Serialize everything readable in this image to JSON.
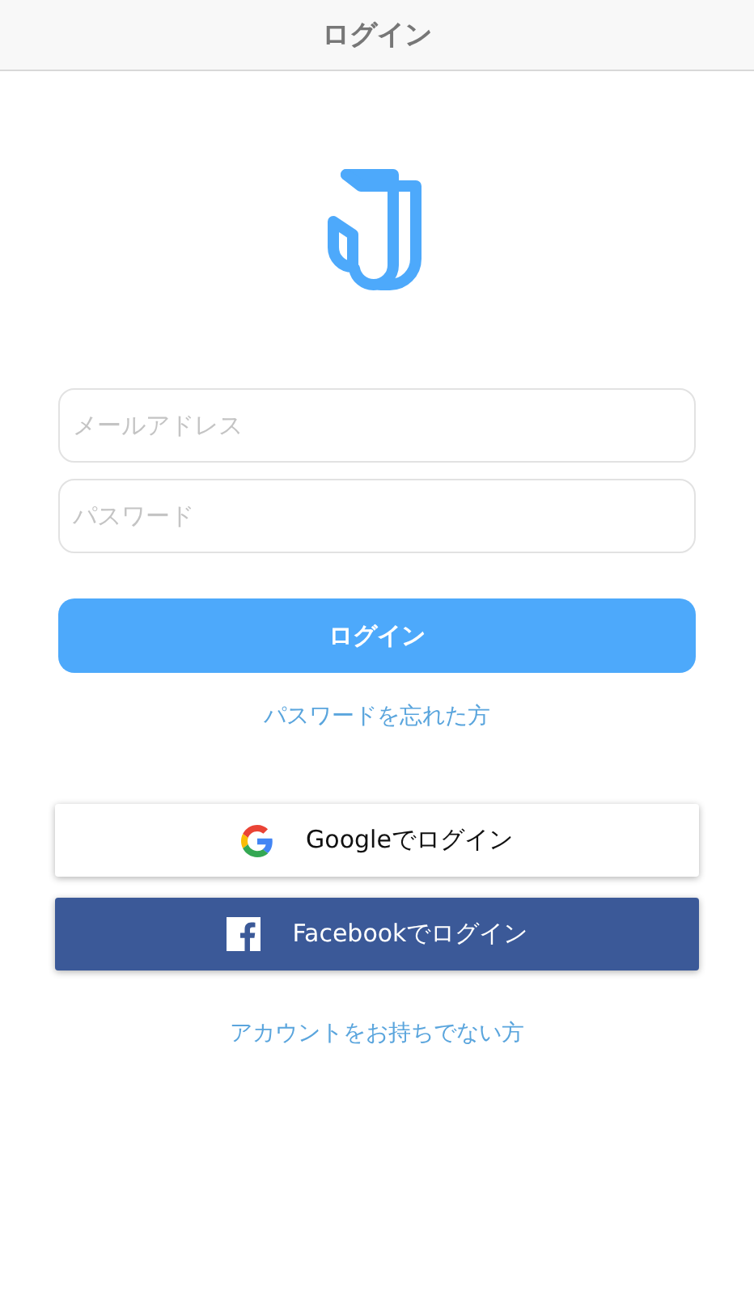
{
  "header": {
    "title": "ログイン"
  },
  "fields": [
    {
      "placeholder": "メールアドレス"
    },
    {
      "placeholder": "パスワード"
    }
  ],
  "login_button": "ログイン",
  "forgot_link": "パスワードを忘れた方",
  "social_buttons": [
    {
      "kind": "google",
      "label": "Googleでログイン"
    },
    {
      "kind": "facebook",
      "label": "Facebookでログイン"
    }
  ],
  "signup_link": "アカウントをお持ちでない方"
}
